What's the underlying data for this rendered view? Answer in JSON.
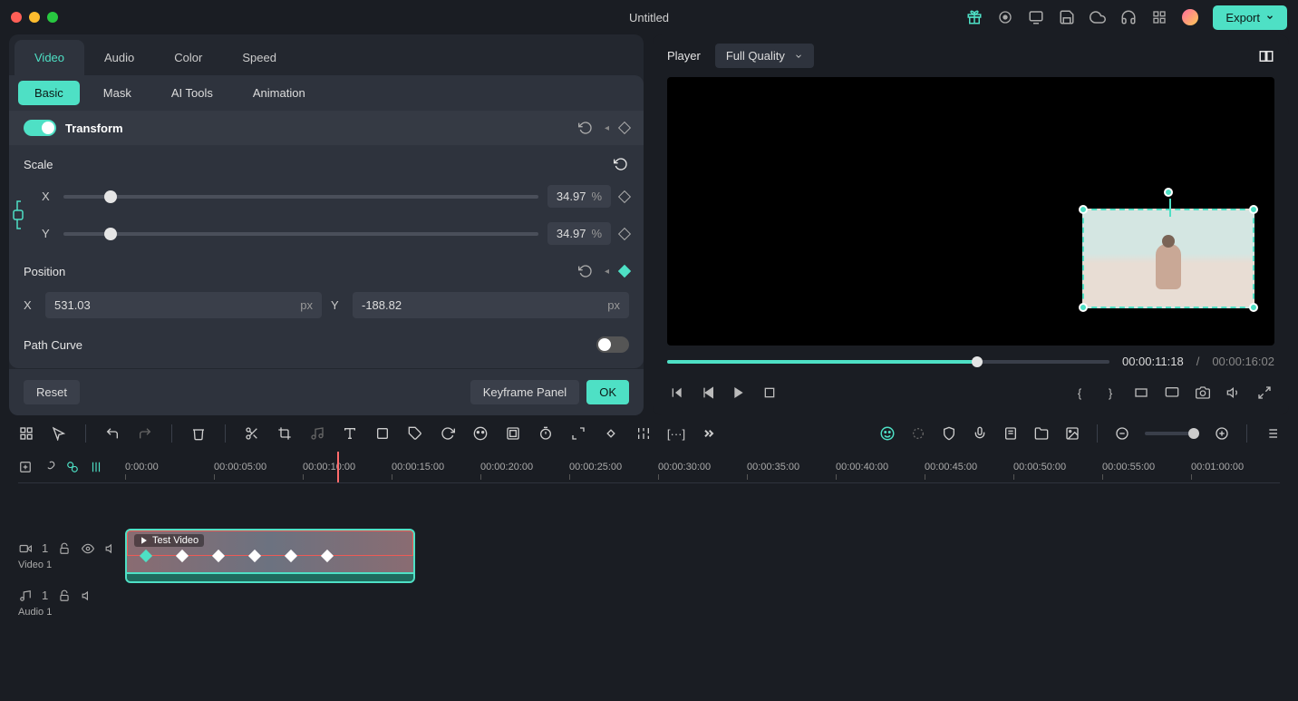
{
  "app_title": "Untitled",
  "export_label": "Export",
  "main_tabs": [
    "Video",
    "Audio",
    "Color",
    "Speed"
  ],
  "sub_tabs": [
    "Basic",
    "Mask",
    "AI Tools",
    "Animation"
  ],
  "transform": {
    "label": "Transform",
    "scale_label": "Scale",
    "scale_x_label": "X",
    "scale_x_value": "34.97",
    "scale_x_unit": "%",
    "scale_y_label": "Y",
    "scale_y_value": "34.97",
    "scale_y_unit": "%",
    "position_label": "Position",
    "pos_x_label": "X",
    "pos_x_value": "531.03",
    "pos_x_unit": "px",
    "pos_y_label": "Y",
    "pos_y_value": "-188.82",
    "pos_y_unit": "px",
    "path_curve_label": "Path Curve"
  },
  "panel_footer": {
    "reset": "Reset",
    "keyframe": "Keyframe Panel",
    "ok": "OK"
  },
  "player": {
    "label": "Player",
    "quality_label": "Full Quality",
    "current_time": "00:00:11:18",
    "separator": "/",
    "total_time": "00:00:16:02"
  },
  "ruler_marks": [
    "0:00:00",
    "00:00:05:00",
    "00:00:10:00",
    "00:00:15:00",
    "00:00:20:00",
    "00:00:25:00",
    "00:00:30:00",
    "00:00:35:00",
    "00:00:40:00",
    "00:00:45:00",
    "00:00:50:00",
    "00:00:55:00",
    "00:01:00:00"
  ],
  "tracks": {
    "video1": {
      "badge": "1",
      "label": "Video 1",
      "clip_label": "Test Video"
    },
    "audio1": {
      "badge": "1",
      "label": "Audio 1"
    }
  },
  "colors": {
    "accent": "#4ee0c5",
    "bg": "#1a1d23",
    "panel": "#2e333d",
    "red": "#ff6b6b"
  }
}
